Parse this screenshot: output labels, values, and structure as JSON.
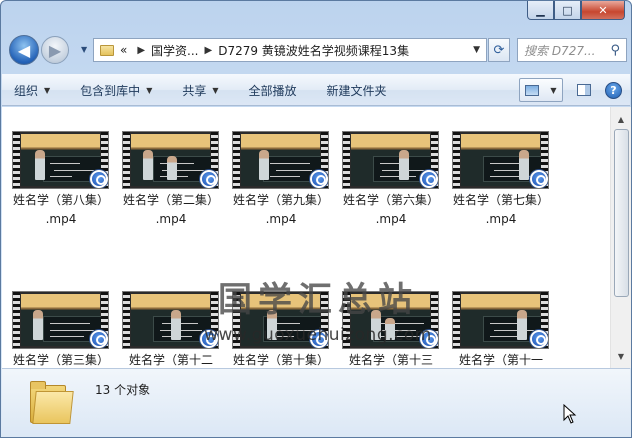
{
  "window": {
    "controls": {
      "minimize": "▁",
      "maximize": "□",
      "close": "✕"
    }
  },
  "nav": {
    "back_glyph": "◀",
    "forward_glyph": "▶",
    "recent_glyph": "▼",
    "breadcrumb": [
      "«",
      "国学资...",
      "D7279 黄镜波姓名学视频课程13集"
    ],
    "breadcrumb_sep": "▶",
    "refresh_glyph": "⟳",
    "search_placeholder": "搜索 D727...",
    "search_icon": "search-icon"
  },
  "toolbar": {
    "items": [
      {
        "label": "组织",
        "has_menu": true
      },
      {
        "label": "包含到库中",
        "has_menu": true
      },
      {
        "label": "共享",
        "has_menu": true
      },
      {
        "label": "全部播放",
        "has_menu": false
      },
      {
        "label": "新建文件夹",
        "has_menu": false
      }
    ],
    "menu_arrow": "▼",
    "help_label": "?"
  },
  "files": [
    {
      "name": "姓名学（第八集）",
      "ext": ".mp4"
    },
    {
      "name": "姓名学（第二集）",
      "ext": ".mp4"
    },
    {
      "name": "姓名学（第九集）",
      "ext": ".mp4"
    },
    {
      "name": "姓名学（第六集）",
      "ext": ".mp4"
    },
    {
      "name": "姓名学（第七集）",
      "ext": ".mp4"
    },
    {
      "name": "姓名学（第三集）",
      "ext": ""
    },
    {
      "name": "姓名学（第十二",
      "ext": ""
    },
    {
      "name": "姓名学（第十集）",
      "ext": ""
    },
    {
      "name": "姓名学（第十三",
      "ext": ""
    },
    {
      "name": "姓名学（第十一",
      "ext": ""
    }
  ],
  "watermark": {
    "cn": "国学汇总站",
    "en": "www.guoxuehuizong.com"
  },
  "status": {
    "count_text": "13 个对象"
  },
  "scrollbar": {
    "up": "▲",
    "down": "▼"
  },
  "colors": {
    "accent": "#1c4fb0",
    "frame": "#5b7aa0",
    "toolbar_text": "#1e395b"
  }
}
